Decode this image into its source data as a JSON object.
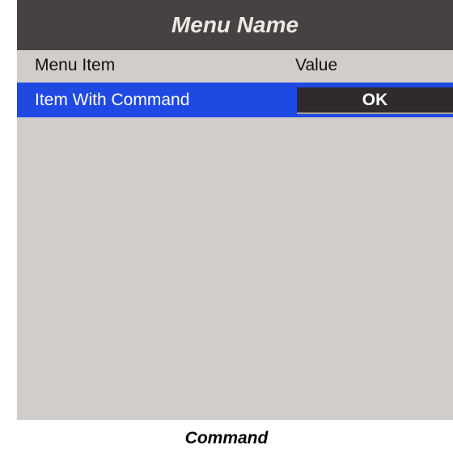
{
  "menu": {
    "title": "Menu Name",
    "rows": [
      {
        "label": "Menu Item",
        "value": "Value"
      },
      {
        "label": "Item With Command",
        "button_label": "OK"
      }
    ]
  },
  "caption": "Command",
  "colors": {
    "header_background": "#474242",
    "panel_background": "#d1cdca",
    "selected_row": "#1f49e2",
    "button_background": "#2f2b2b"
  }
}
